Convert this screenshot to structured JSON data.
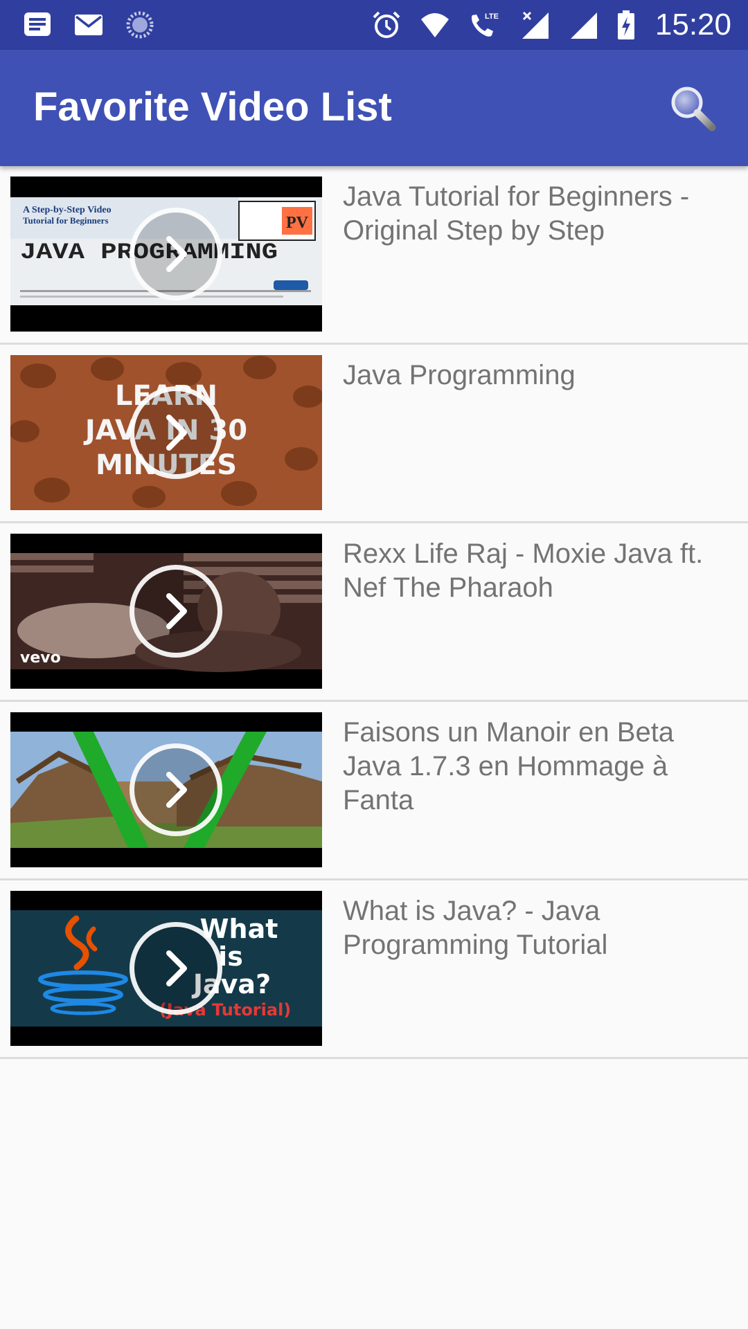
{
  "status_bar": {
    "left_icons": [
      "notification-list-icon",
      "mail-icon",
      "sync-icon"
    ],
    "right_icons": [
      "alarm-icon",
      "wifi-icon",
      "lte-call-icon",
      "signal-x-icon",
      "signal-icon",
      "battery-charging-icon"
    ],
    "lte_label": "LTE",
    "time": "15:20"
  },
  "app_bar": {
    "title": "Favorite Video List",
    "search_icon": "search-icon",
    "background": "#3f51b5",
    "status_background": "#303f9f"
  },
  "videos": [
    {
      "title": "Java Tutorial for Beginners - Original Step by Step",
      "thumb_text": {
        "line1": "A Step-by-Step Video",
        "line2": "Tutorial for Beginners",
        "main": "JAVA PROGRAMMING",
        "badge": "PV"
      }
    },
    {
      "title": "Java Programming",
      "thumb_text": {
        "line1": "LEARN",
        "line2": "JAVA IN 30",
        "line3": "MINUTES"
      }
    },
    {
      "title": "Rexx Life Raj - Moxie Java ft. Nef The Pharaoh",
      "thumb_text": {
        "watermark": "vevo"
      }
    },
    {
      "title": "Faisons un Manoir en Beta Java 1.7.3 en Hommage à Fanta",
      "thumb_text": {}
    },
    {
      "title": "What is Java? - Java Programming Tutorial",
      "thumb_text": {
        "line1": "What",
        "line2": "is",
        "line3": "Java?",
        "line4": "(Java Tutorial)"
      }
    }
  ]
}
